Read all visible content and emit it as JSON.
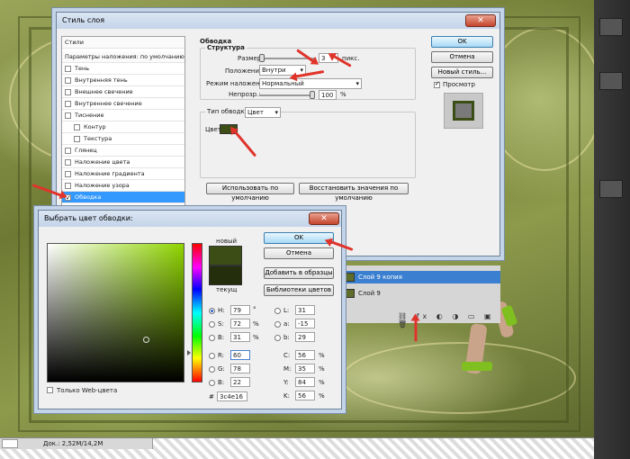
{
  "colors": {
    "selected_color": "#3c4e16",
    "highlight": "#3399ff",
    "annotation_arrow": "#e0342b"
  },
  "statusbar": {
    "doc_info": "Док.: 2,52M/14,2M"
  },
  "layer_style": {
    "title": "Стиль слоя",
    "styles_header": "Стили",
    "blend_options": "Параметры наложения: по умолчанию",
    "items": [
      {
        "label": "Тень",
        "checked": false
      },
      {
        "label": "Внутренняя тень",
        "checked": false
      },
      {
        "label": "Внешнее свечение",
        "checked": false
      },
      {
        "label": "Внутреннее свечение",
        "checked": false
      },
      {
        "label": "Тиснение",
        "checked": false
      },
      {
        "label": "Контур",
        "checked": false
      },
      {
        "label": "Текстура",
        "checked": false
      },
      {
        "label": "Глянец",
        "checked": false
      },
      {
        "label": "Наложение цвета",
        "checked": false
      },
      {
        "label": "Наложение градиента",
        "checked": false
      },
      {
        "label": "Наложение узора",
        "checked": false
      },
      {
        "label": "Обводка",
        "checked": true
      }
    ],
    "section_title": "Обводка",
    "structure_title": "Структура",
    "size_label": "Размер:",
    "size_value": "3",
    "size_unit": "пикс.",
    "position_label": "Положение:",
    "position_value": "Внутри",
    "blend_mode_label": "Режим наложения:",
    "blend_mode_value": "Нормальный",
    "opacity_label": "Непрозр.:",
    "opacity_value": "100",
    "opacity_unit": "%",
    "fill_type_label": "Тип обводки:",
    "fill_type_value": "Цвет",
    "color_label": "Цвет:",
    "use_default_button": "Использовать по умолчанию",
    "restore_default_button": "Восстановить значения по умолчанию",
    "ok_button": "OK",
    "cancel_button": "Отмена",
    "new_style_button": "Новый стиль...",
    "preview_label": "Просмотр",
    "preview_checked": true
  },
  "layers": {
    "rows": [
      {
        "name": "Слой 9 копия",
        "selected": true
      },
      {
        "name": "Слой 9",
        "selected": false
      }
    ]
  },
  "color_picker": {
    "title": "Выбрать цвет обводки:",
    "new_label": "новый",
    "current_label": "текущ",
    "ok_button": "OK",
    "cancel_button": "Отмена",
    "add_swatch_button": "Добавить в образцы",
    "libraries_button": "Библиотеки цветов",
    "web_only_label": "Только Web-цвета",
    "web_only_checked": false,
    "h_label": "H:",
    "h_value": "79",
    "h_unit": "°",
    "s_label": "S:",
    "s_value": "72",
    "s_unit": "%",
    "b_label": "B:",
    "b_value": "31",
    "b_unit": "%",
    "r_label": "R:",
    "r_value": "60",
    "g_label": "G:",
    "g_value": "78",
    "bl_label": "B:",
    "bl_value": "22",
    "l_label": "L:",
    "l_value": "31",
    "a_label": "a:",
    "a_value": "-15",
    "lab_b_label": "b:",
    "lab_b_value": "29",
    "c_label": "C:",
    "c_value": "56",
    "c_unit": "%",
    "m_label": "M:",
    "m_value": "35",
    "m_unit": "%",
    "y_label": "Y:",
    "y_value": "84",
    "y_unit": "%",
    "k_label": "K:",
    "k_value": "56",
    "k_unit": "%",
    "hex_label": "#",
    "hex_value": "3c4e16",
    "hue_fraction": 0.22,
    "saturation_fraction": 0.72,
    "brightness_fraction": 0.31
  }
}
